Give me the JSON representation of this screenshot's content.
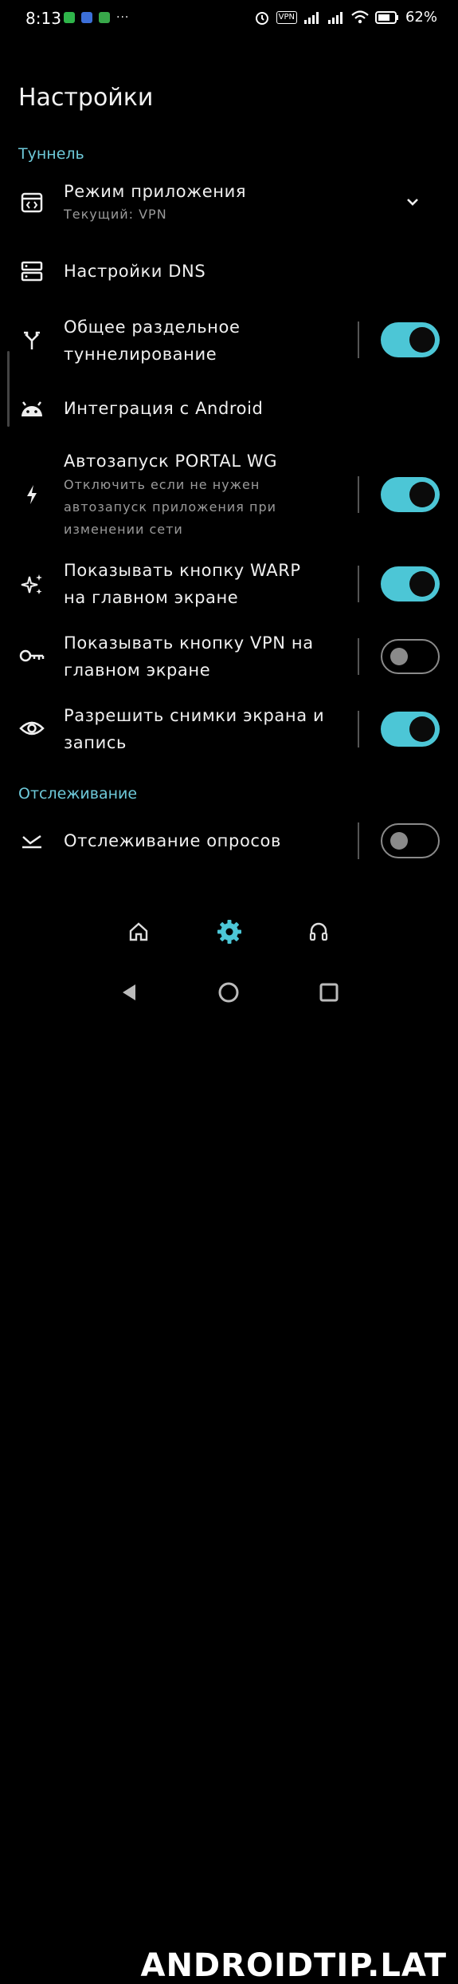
{
  "status_bar": {
    "time": "8:13",
    "dots": "···",
    "vpn": "VPN",
    "battery": "62%"
  },
  "title": "Настройки",
  "sections": {
    "tunnel": "Туннель",
    "tracking": "Отслеживание"
  },
  "items": {
    "app_mode": {
      "title": "Режим приложения",
      "subtitle": "Текущий: VPN",
      "icon": "app-mode-icon"
    },
    "dns": {
      "title": "Настройки DNS",
      "icon": "dns-icon"
    },
    "split_tunnel": {
      "line1": "Общее раздельное",
      "line2": "туннелирование",
      "toggle": true,
      "icon": "split-icon"
    },
    "android": {
      "title": "Интеграция с Android",
      "icon": "android-icon"
    },
    "autostart": {
      "title": "Автозапуск PORTAL WG",
      "sub1": "Отключить если не нужен",
      "sub2": "автозапуск приложения при",
      "sub3": "изменении сети",
      "toggle": true,
      "icon": "bolt-icon"
    },
    "warp": {
      "line1": "Показывать кнопку WARP",
      "line2": "на главном экране",
      "toggle": true,
      "icon": "sparkle-icon"
    },
    "vpn_btn": {
      "line1": "Показывать кнопку VPN на",
      "line2": "главном экране",
      "toggle": false,
      "icon": "key-icon"
    },
    "screenshots": {
      "line1": "Разрешить снимки экрана и",
      "line2": "запись",
      "toggle": true,
      "icon": "eye-icon"
    },
    "polls": {
      "title": "Отслеживание опросов",
      "toggle": false,
      "icon": "poll-tracking-icon"
    }
  },
  "nav": {
    "home": "home-icon",
    "settings": "gear-icon",
    "support": "headset-icon"
  },
  "watermark": "ANDROIDTIP.LAT",
  "colors": {
    "accent": "#4cc6d6",
    "section": "#6ec9d9"
  }
}
